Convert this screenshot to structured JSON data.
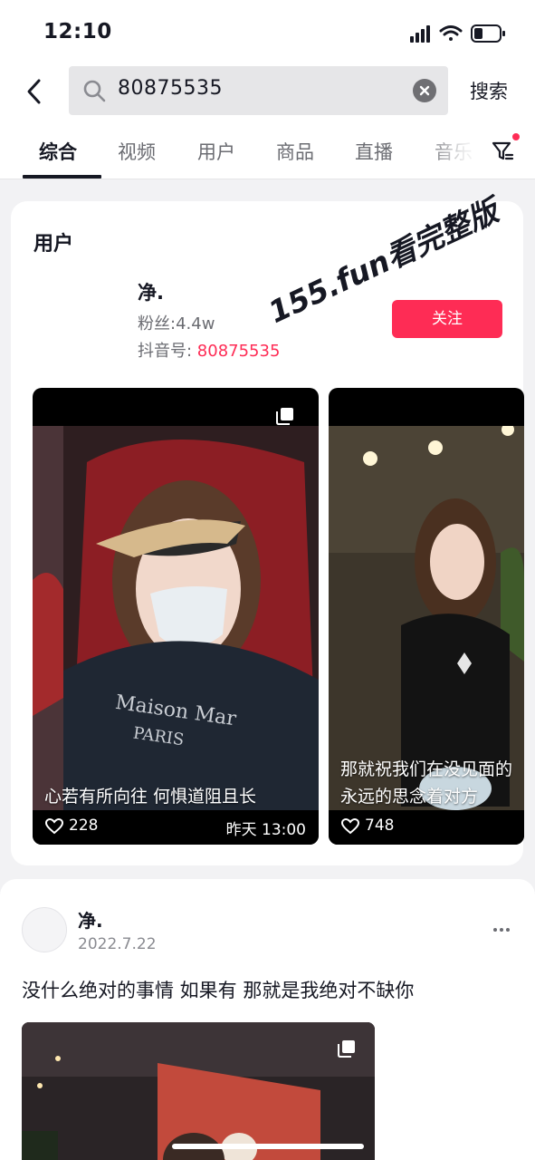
{
  "status_bar": {
    "time": "12:10"
  },
  "search": {
    "query": "80875535",
    "submit_label": "搜索"
  },
  "tabs": [
    {
      "label": "综合",
      "active": true
    },
    {
      "label": "视频",
      "active": false
    },
    {
      "label": "用户",
      "active": false
    },
    {
      "label": "商品",
      "active": false
    },
    {
      "label": "直播",
      "active": false
    },
    {
      "label": "音乐",
      "active": false
    }
  ],
  "user_section": {
    "title": "用户",
    "name": "净.",
    "followers": "粉丝:4.4w",
    "id_label": "抖音号: ",
    "id_value": "80875535",
    "follow_label": "关注",
    "watermark": "155.fun看完整版"
  },
  "videos": [
    {
      "caption": "心若有所向往  何惧道阻且长",
      "likes": "228",
      "time": "昨天 13:00"
    },
    {
      "caption_lines": [
        "那就祝我们在没见面的",
        "永远的思念着对方"
      ],
      "likes": "748"
    }
  ],
  "post": {
    "author": "净.",
    "date": "2022.7.22",
    "text": "没什么绝对的事情 如果有 那就是我绝对不缺你"
  },
  "colors": {
    "accent": "#fe2c55",
    "text_primary": "#161823",
    "text_secondary": "#6b6c72"
  },
  "icons": [
    "back-icon",
    "search-icon",
    "clear-icon",
    "filter-icon",
    "multi-image-icon",
    "heart-icon",
    "more-icon"
  ]
}
